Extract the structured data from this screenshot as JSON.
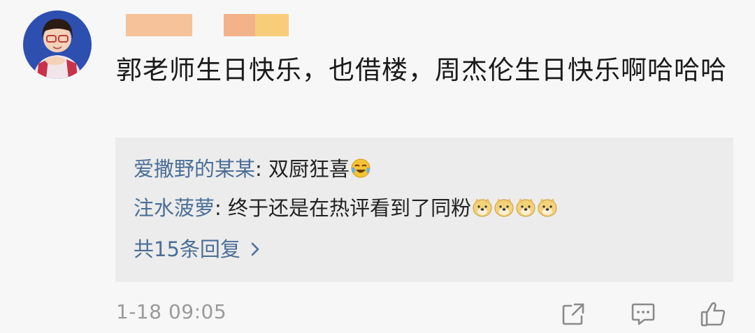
{
  "comment": {
    "text": "郭老师生日快乐，也借楼，周杰伦生日快乐啊哈哈哈",
    "timestamp": "1-18 09:05"
  },
  "replies": [
    {
      "name": "爱撒野的某某",
      "separator": ": ",
      "text": "双厨狂喜",
      "emojis": [
        "laugh-cry-emoji"
      ]
    },
    {
      "name": "注水菠萝",
      "separator": ": ",
      "text": "终于还是在热评看到了同粉",
      "emojis": [
        "doge-emoji",
        "doge-emoji",
        "doge-emoji",
        "doge-emoji"
      ]
    }
  ],
  "more_replies_label": "共15条回复",
  "icons": {
    "more_chevron": "chevron-right-icon",
    "share": "share-icon",
    "reply": "comment-icon",
    "like": "thumbs-up-icon"
  },
  "colors": {
    "username_link": "#4b6e96",
    "reply_box_bg": "#ececec",
    "username_blur_1": "#f5b88a",
    "username_blur_2": "#f7c86a"
  }
}
